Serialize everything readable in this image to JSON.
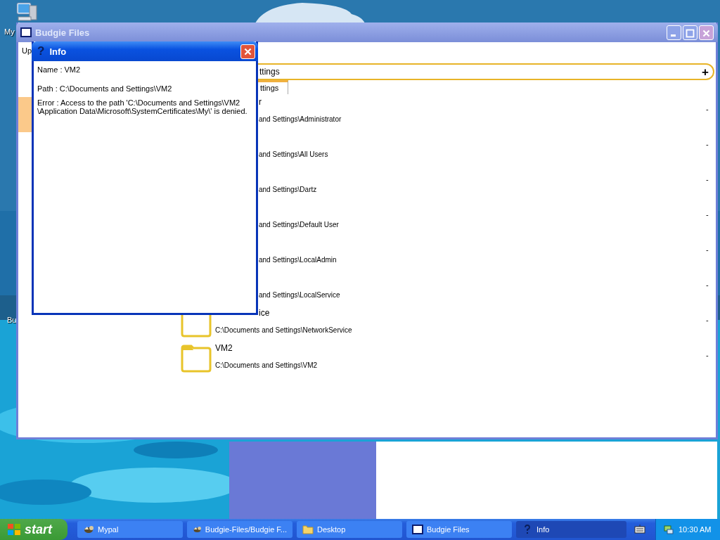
{
  "desktop": {
    "icons": [
      {
        "label": "My"
      },
      {
        "label": "Bu"
      }
    ]
  },
  "main_window": {
    "title": "Budgie Files",
    "up_label": "Up",
    "address": {
      "value": "ttings",
      "add_symbol": "+"
    },
    "tab": {
      "label": "ttings",
      "selected": true
    },
    "rows": [
      {
        "kind": "covered",
        "name": "r",
        "path": "and Settings\\Administrator",
        "size": "-"
      },
      {
        "kind": "covered",
        "path": "and Settings\\All Users",
        "size": "-"
      },
      {
        "kind": "covered",
        "path": "and Settings\\Dartz",
        "size": "-"
      },
      {
        "kind": "covered",
        "path": "and Settings\\Default User",
        "size": "-"
      },
      {
        "kind": "covered",
        "path": "and Settings\\LocalAdmin",
        "size": "-"
      },
      {
        "kind": "covered",
        "path": "and Settings\\LocalService",
        "size": "-"
      },
      {
        "kind": "partly_covered",
        "name": "ice",
        "path": "C:\\Documents and Settings\\NetworkService",
        "size": "-"
      },
      {
        "kind": "full",
        "name": "VM2",
        "path": "C:\\Documents and Settings\\VM2",
        "size": "-"
      }
    ]
  },
  "info_dialog": {
    "title": "Info",
    "title_icon": "?",
    "name_line": "Name : VM2",
    "path_line": "Path : C:\\Documents and Settings\\VM2",
    "error_lines": [
      "Error : Access to the path 'C:\\Documents and Settings\\VM2",
      "\\Application Data\\Microsoft\\SystemCertificates\\My\\' is denied."
    ]
  },
  "taskbar": {
    "start_label": "start",
    "items": [
      {
        "kind": "bird",
        "label": "Mypal",
        "selected": false
      },
      {
        "kind": "bird",
        "label": "Budgie-Files/Budgie F...",
        "selected": false
      },
      {
        "kind": "folder",
        "label": "Desktop",
        "selected": false
      },
      {
        "kind": "window",
        "label": "Budgie Files",
        "selected": false
      },
      {
        "kind": "help",
        "label": "Info",
        "selected": true
      }
    ],
    "clock": "10:30 AM"
  }
}
